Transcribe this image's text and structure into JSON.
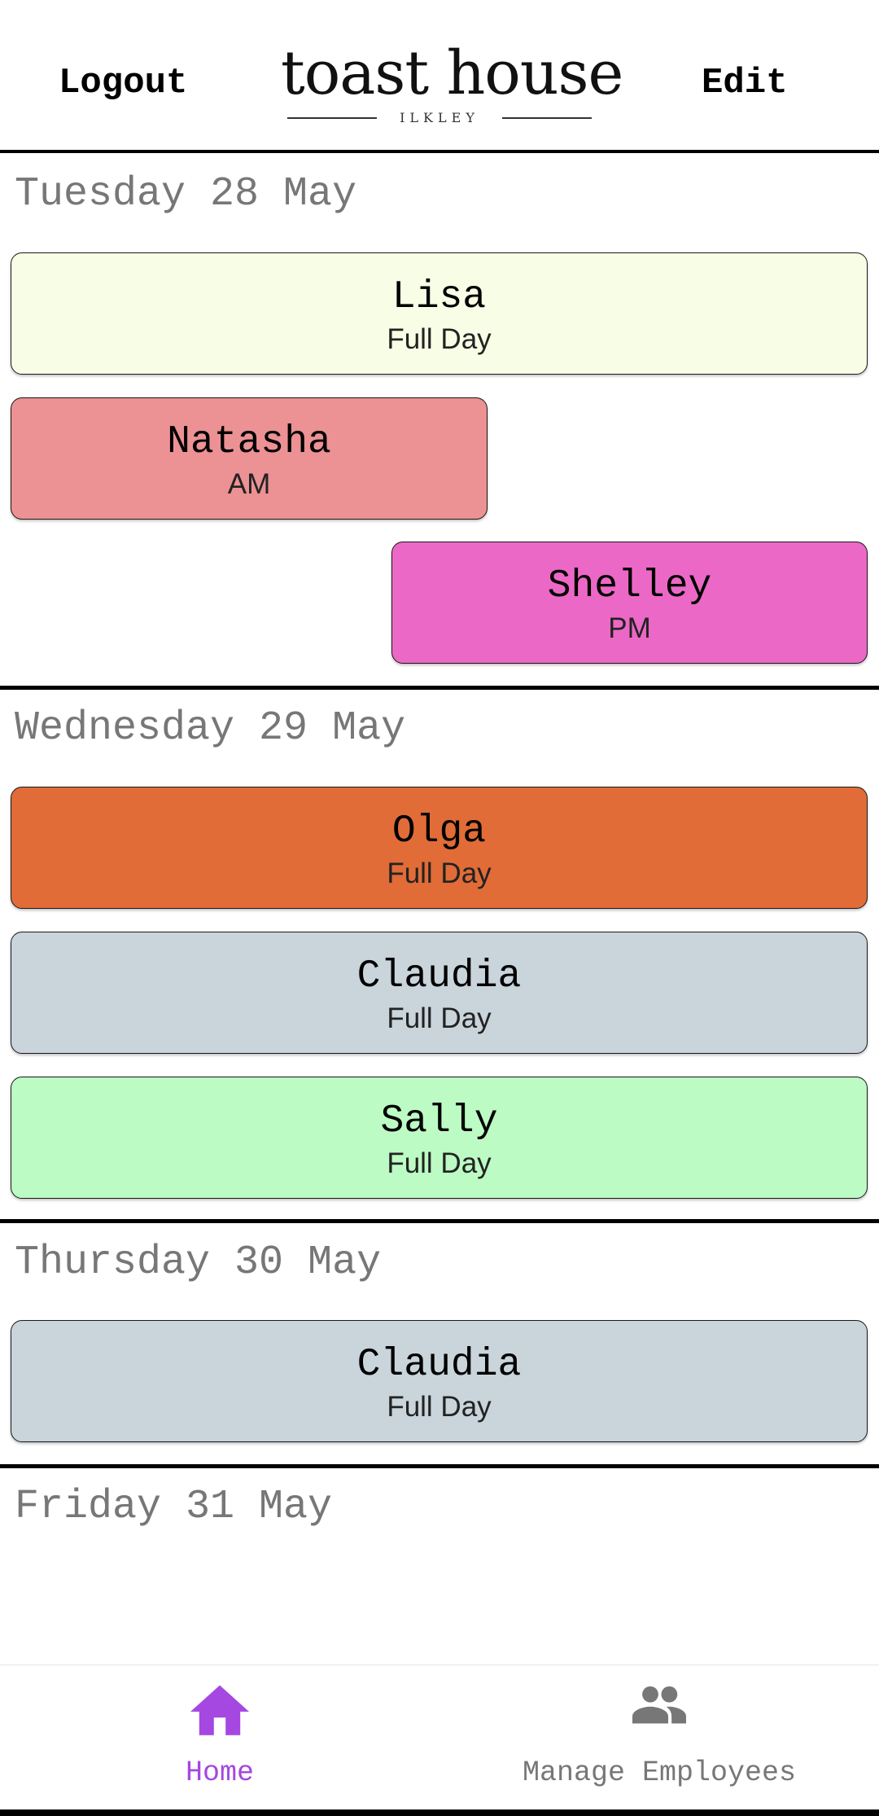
{
  "header": {
    "logout_label": "Logout",
    "edit_label": "Edit",
    "logo_name": "toast house",
    "logo_place": "ILKLEY"
  },
  "days": [
    {
      "title": "Tuesday 28 May",
      "shifts": [
        {
          "name": "Lisa",
          "type": "Full Day",
          "color": "#f8fde5"
        },
        {
          "name": "Natasha",
          "type": "AM",
          "color": "#ec9194"
        },
        {
          "name": "Shelley",
          "type": "PM",
          "color": "#ec68c6"
        }
      ]
    },
    {
      "title": "Wednesday 29 May",
      "shifts": [
        {
          "name": "Olga",
          "type": "Full Day",
          "color": "#e16c37"
        },
        {
          "name": "Claudia",
          "type": "Full Day",
          "color": "#c9d4db"
        },
        {
          "name": "Sally",
          "type": "Full Day",
          "color": "#bcfbc4"
        }
      ]
    },
    {
      "title": "Thursday 30 May",
      "shifts": [
        {
          "name": "Claudia",
          "type": "Full Day",
          "color": "#c9d4db"
        }
      ]
    },
    {
      "title": "Friday 31 May",
      "shifts": []
    }
  ],
  "bottom_nav": {
    "items": [
      {
        "label": "Home",
        "icon": "home-icon",
        "active": true
      },
      {
        "label": "Manage Employees",
        "icon": "people-icon",
        "active": false
      }
    ],
    "active_color": "#a547e1",
    "inactive_color": "#777777"
  }
}
